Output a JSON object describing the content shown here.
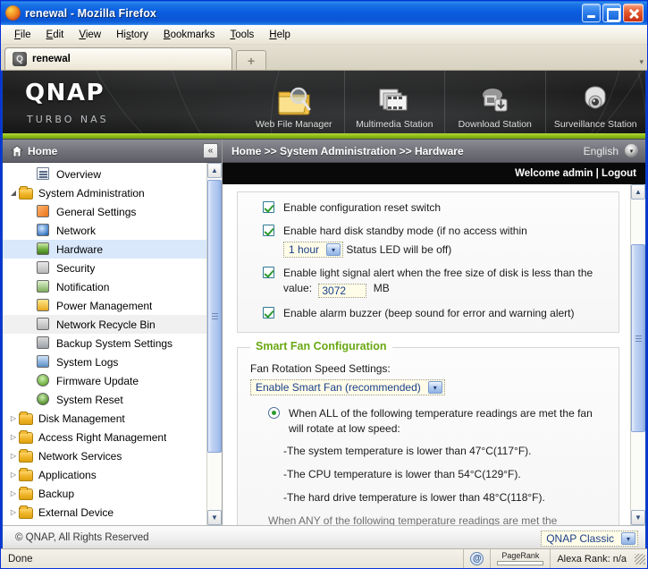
{
  "browser": {
    "window_title": "renewal - Mozilla Firefox",
    "menu": [
      "File",
      "Edit",
      "View",
      "History",
      "Bookmarks",
      "Tools",
      "Help"
    ],
    "tab_title": "renewal",
    "tab_favicon_glyph": "Q",
    "new_tab_label": "+",
    "tab_scroll_glyph": "▾",
    "window_buttons": {
      "minimize": "–",
      "maximize": "□",
      "close": "✕"
    },
    "status_text": "Done",
    "toolbar_right": {
      "at_icon": "@",
      "pagerank_label": "PageRank",
      "alexa_label": "Alexa Rank: n/a"
    }
  },
  "banner": {
    "logo": "QNAP",
    "tagline": "TURBO NAS",
    "apps": [
      {
        "label": "Web File Manager",
        "icon": "folder-search-icon"
      },
      {
        "label": "Multimedia Station",
        "icon": "multimedia-icon"
      },
      {
        "label": "Download Station",
        "icon": "download-icon"
      },
      {
        "label": "Surveillance Station",
        "icon": "camera-icon"
      }
    ]
  },
  "sidebar": {
    "header": "Home",
    "header_icon": "home-icon",
    "collapse_glyph": "«",
    "items": [
      {
        "label": "Overview",
        "level": 2,
        "icon": "overview-icon",
        "twisty": "",
        "state": ""
      },
      {
        "label": "System Administration",
        "level": 1,
        "icon": "folder-icon",
        "twisty": "◢",
        "state": ""
      },
      {
        "label": "General Settings",
        "level": 2,
        "icon": "general-icon",
        "twisty": "",
        "state": ""
      },
      {
        "label": "Network",
        "level": 2,
        "icon": "network-icon",
        "twisty": "",
        "state": ""
      },
      {
        "label": "Hardware",
        "level": 2,
        "icon": "hardware-icon",
        "twisty": "",
        "state": "selected"
      },
      {
        "label": "Security",
        "level": 2,
        "icon": "security-icon",
        "twisty": "",
        "state": ""
      },
      {
        "label": "Notification",
        "level": 2,
        "icon": "notification-icon",
        "twisty": "",
        "state": ""
      },
      {
        "label": "Power Management",
        "level": 2,
        "icon": "power-icon",
        "twisty": "",
        "state": ""
      },
      {
        "label": "Network Recycle Bin",
        "level": 2,
        "icon": "recyclebin-icon",
        "twisty": "",
        "state": "alt"
      },
      {
        "label": "Backup System Settings",
        "level": 2,
        "icon": "backup-icon",
        "twisty": "",
        "state": ""
      },
      {
        "label": "System Logs",
        "level": 2,
        "icon": "logs-icon",
        "twisty": "",
        "state": ""
      },
      {
        "label": "Firmware Update",
        "level": 2,
        "icon": "firmware-icon",
        "twisty": "",
        "state": ""
      },
      {
        "label": "System Reset",
        "level": 2,
        "icon": "reset-icon",
        "twisty": "",
        "state": ""
      },
      {
        "label": "Disk Management",
        "level": 1,
        "icon": "folder-icon",
        "twisty": "▷",
        "state": ""
      },
      {
        "label": "Access Right Management",
        "level": 1,
        "icon": "folder-icon",
        "twisty": "▷",
        "state": ""
      },
      {
        "label": "Network Services",
        "level": 1,
        "icon": "folder-icon",
        "twisty": "▷",
        "state": ""
      },
      {
        "label": "Applications",
        "level": 1,
        "icon": "folder-icon",
        "twisty": "▷",
        "state": ""
      },
      {
        "label": "Backup",
        "level": 1,
        "icon": "folder-icon",
        "twisty": "▷",
        "state": ""
      },
      {
        "label": "External Device",
        "level": 1,
        "icon": "folder-icon",
        "twisty": "▷",
        "state": ""
      }
    ]
  },
  "content": {
    "breadcrumb": "Home >> System Administration >> Hardware",
    "language": "English",
    "welcome": "Welcome admin | Logout",
    "hardware_options": [
      {
        "label": "Enable configuration reset switch",
        "checked": true
      },
      {
        "label": "Enable hard disk standby mode (if no access within",
        "checked": true
      },
      {
        "label": "Enable light signal alert when the free size of disk is less than the",
        "checked": true
      },
      {
        "label": "Enable alarm buzzer (beep sound for error and warning alert)",
        "checked": true
      }
    ],
    "standby_select_value": "1 hour",
    "standby_suffix": "Status LED will be off)",
    "light_signal_value_label": "value:",
    "light_signal_value": "3072",
    "light_signal_unit": "MB",
    "smart_fan": {
      "legend": "Smart Fan Configuration",
      "fan_speed_label": "Fan Rotation Speed Settings:",
      "fan_speed_value": "Enable Smart Fan (recommended)",
      "radio_all_label": "When ALL of the following temperature readings are met the fan will rotate at low speed:",
      "conditions": [
        "-The system temperature is lower than 47°C(117°F).",
        "-The CPU temperature is lower than 54°C(129°F).",
        "-The hard drive temperature is lower than 48°C(118°F)."
      ],
      "radio_any_label": "When ANY of the following temperature readings are met the"
    },
    "footer_copyright": "© QNAP, All Rights Reserved",
    "theme_value": "QNAP Classic"
  },
  "colors": {
    "accent_green": "#6aa814",
    "banner_dark": "#1d1d1d",
    "titlebar_blue": "#0053ee",
    "selected_row": "#d9e8fb",
    "strip_green": "#8fbe18"
  },
  "icons": {
    "dropdown_arrow": "▾",
    "scroll_up": "▲",
    "scroll_down": "▼"
  }
}
